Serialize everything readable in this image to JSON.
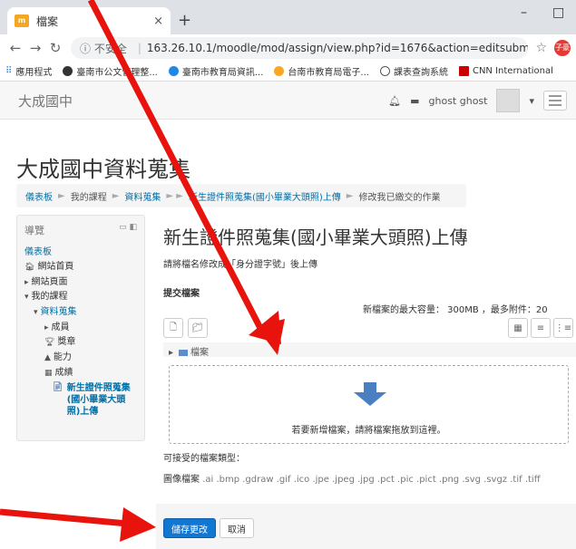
{
  "browser": {
    "tab_title": "檔案",
    "tab_close": "×",
    "new_tab": "+",
    "minimize": "–",
    "maximize": "□",
    "security": "ⓘ 不安全",
    "url": "163.26.10.1/moodle/mod/assign/view.php?id=1676&action=editsubmission",
    "profile": "子豪",
    "bookmarks": [
      "應用程式",
      "臺南市公文管理整...",
      "臺南市教育局資訊...",
      "台南市教育局電子...",
      "課表查詢系統",
      "CNN International"
    ]
  },
  "navbar": {
    "brand": "大成國中",
    "user": "ghost ghost"
  },
  "site_title": "大成國中資料蒐集",
  "breadcrumb": [
    "儀表板",
    "我的課程",
    "資料蒐集",
    "新生證件照蒐集(國小畢業大頭照)上傳",
    "修改我已繳交的作業"
  ],
  "nav": {
    "title": "導覽",
    "dashboard": "儀表板",
    "site_home": "網站首頁",
    "site_pages": "網站頁面",
    "my_courses": "我的課程",
    "course": "資料蒐集",
    "members": "成員",
    "badges": "獎章",
    "competencies": "能力",
    "grades": "成績",
    "active": "新生證件照蒐集(國小畢業大頭照)上傳"
  },
  "main": {
    "title": "新生證件照蒐集(國小畢業大頭照)上傳",
    "intro": "請將檔名修改成「身分證字號」後上傳",
    "section": "提交檔案",
    "max_size": "新檔案的最大容量： 300MB ，最多附件：20",
    "folder": "檔案",
    "drop_text": "若要新增檔案，請將檔案拖放到這裡。",
    "accepted_label": "可接受的檔案類型：",
    "types_label": "圖像檔案",
    "types_ext": ".ai .bmp .gdraw .gif .ico .jpe .jpeg .jpg .pct .pic .pict .png .svg .svgz .tif .tiff",
    "save": "儲存更改",
    "cancel": "取消"
  },
  "colors": {
    "primary": "#1177d1",
    "annotation": "#e8130d",
    "link": "#0070a8"
  }
}
